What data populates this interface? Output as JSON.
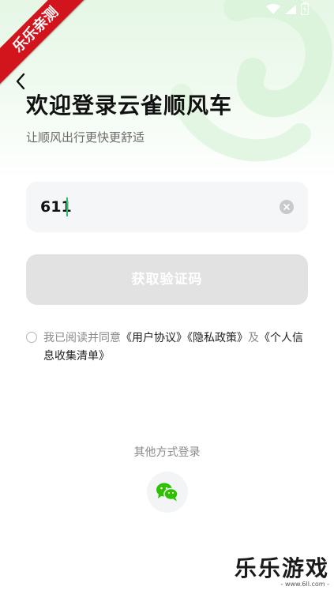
{
  "ribbon_text": "乐乐亲测",
  "status_icons": [
    "wifi-icon",
    "signal-icon",
    "battery-icon"
  ],
  "title": "欢迎登录云雀顺风车",
  "subtitle": "让顺风出行更快更舒适",
  "phone": {
    "value": "611"
  },
  "get_code_label": "获取验证码",
  "agreement": {
    "prefix": "我已阅读并同意",
    "user_agreement": "《用户协议》",
    "privacy_policy": "《隐私政策》",
    "conj": "及",
    "personal_info": "《个人信息收集清单》"
  },
  "other_login_label": "其他方式登录",
  "watermark": {
    "main": "乐乐游戏",
    "sub": "- www.6ll.com -"
  },
  "colors": {
    "accent": "#27c26c",
    "wechat": "#2dc100",
    "ribbon": "#d2141c"
  }
}
